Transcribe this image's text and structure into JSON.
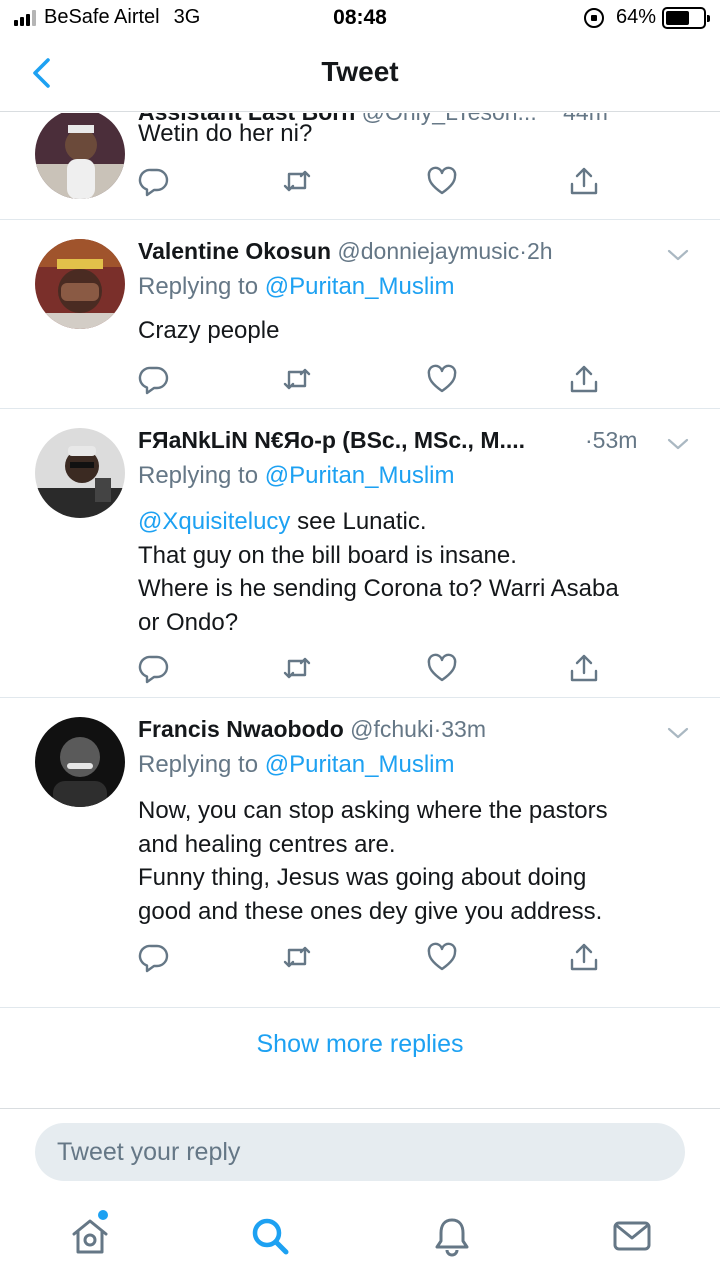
{
  "status_bar": {
    "carrier": "BeSafe Airtel",
    "network": "3G",
    "time": "08:48",
    "battery": "64%",
    "battery_level": 0.64
  },
  "nav": {
    "title": "Tweet",
    "back_icon": "chevron-left-icon"
  },
  "partial_tweet": {
    "name": "Assistant Last Born",
    "handle": "@Only_LTeson...",
    "time": "44m"
  },
  "tweets": [
    {
      "name": "",
      "handle": "",
      "dot": "",
      "time": "",
      "replying_label": "",
      "replying_to": "",
      "body": [
        "Wetin do her ni?"
      ]
    },
    {
      "name": "Valentine Okosun",
      "handle": "@donniejaymusic",
      "dot": "·",
      "time": "2h",
      "replying_label": "Replying to",
      "replying_to": "@Puritan_Muslim",
      "body": [
        "Crazy people"
      ]
    },
    {
      "name": "FЯaNkLiN N€Яo-p (BSc., MSc., M....",
      "handle": "",
      "dot": "·",
      "time": "53m",
      "replying_label": "Replying to",
      "replying_to": "@Puritan_Muslim",
      "body_mention": "@Xquisitelucy",
      "body": [
        " see Lunatic.",
        "That guy on the bill board is insane.",
        "Where is he sending Corona to? Warri Asaba",
        "or Ondo?"
      ]
    },
    {
      "name": "Francis Nwaobodo",
      "handle": "@fchuki",
      "dot": "·",
      "time": "33m",
      "replying_label": "Replying to",
      "replying_to": "@Puritan_Muslim",
      "body": [
        "Now, you can stop asking where the pastors",
        "and healing centres are.",
        "Funny thing, Jesus was going about doing",
        "good and these ones dey give you address."
      ]
    }
  ],
  "actions": {
    "icons": [
      "reply-icon",
      "retweet-icon",
      "like-icon",
      "share-icon"
    ]
  },
  "show_more": "Show more replies",
  "reply_input": {
    "placeholder": "Tweet your reply"
  },
  "tabs": {
    "icons": [
      "home-icon",
      "search-icon",
      "notifications-icon",
      "messages-icon"
    ]
  },
  "colors": {
    "accent": "#1da1f2",
    "secondary_text": "#657786",
    "divider": "#e1e8ed"
  }
}
